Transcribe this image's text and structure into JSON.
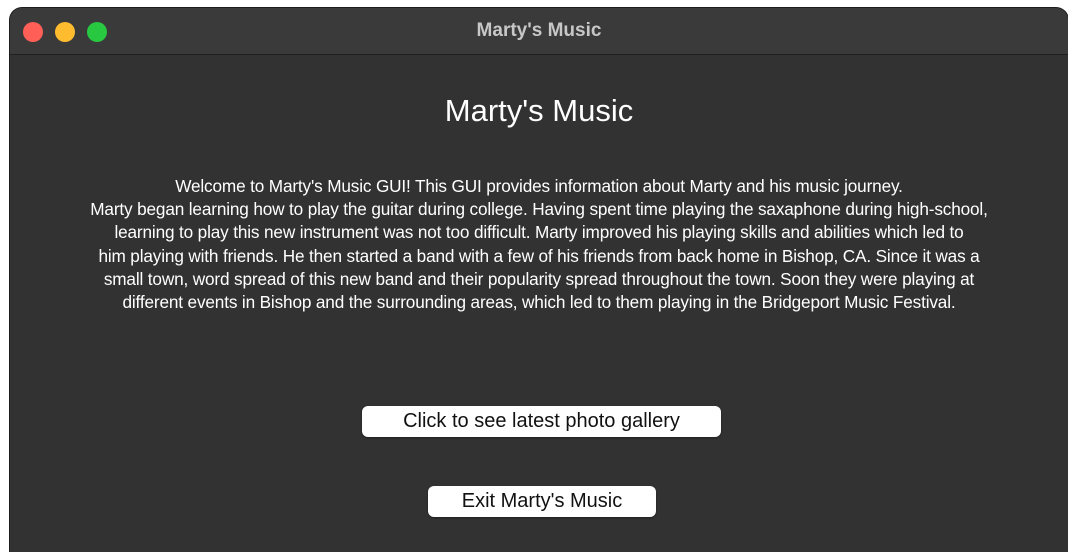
{
  "window": {
    "title": "Marty's Music"
  },
  "main": {
    "heading": "Marty's Music",
    "description_lines": [
      "Welcome to Marty's Music GUI! This GUI provides information about Marty and his music journey.",
      "Marty began learning how to play the guitar during college. Having spent time playing the saxaphone during high-school,",
      "learning to play this new instrument was not too difficult. Marty improved his playing skills and abilities which led to",
      "him playing with friends. He then started a band with a few of his friends from back home in Bishop, CA. Since it was a",
      "small town, word spread of this new band and their popularity spread throughout the town. Soon they were playing at",
      "different events in Bishop and the surrounding areas, which led to them playing in the Bridgeport Music Festival."
    ],
    "gallery_button_label": "Click to see latest photo gallery",
    "exit_button_label": "Exit Marty's Music"
  },
  "colors": {
    "window_background": "#323232",
    "titlebar_background": "#3a3a3a",
    "close": "#ff5f57",
    "minimize": "#febc2e",
    "zoom": "#28c840",
    "text": "#ffffff",
    "button_background": "#ffffff"
  }
}
